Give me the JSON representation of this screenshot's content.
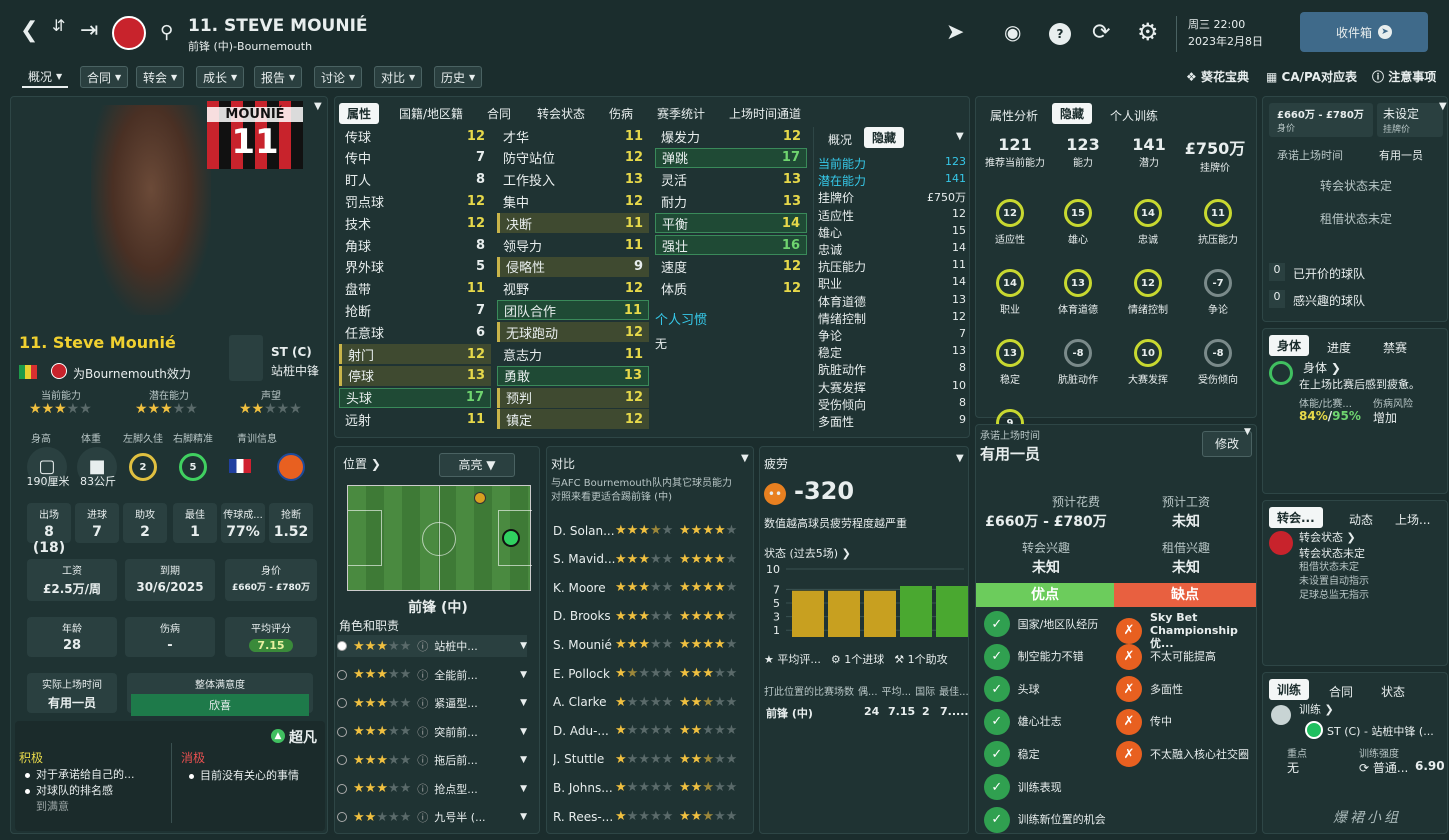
{
  "header": {
    "player_title": "11. STEVE MOUNIÉ",
    "subtitle": "前锋 (中)-Bournemouth",
    "day": "周三 22:00",
    "date": "2023年2月8日",
    "inbox_label": "收件箱"
  },
  "nav_menu": [
    "概况",
    "合同",
    "转会",
    "成长",
    "报告",
    "讨论",
    "对比",
    "历史"
  ],
  "nav_right": [
    "葵花宝典",
    "CA/PA对应表",
    "注意事项"
  ],
  "profile": {
    "shirt_name": "MOUNIÉ",
    "shirt_number": "11",
    "name": "11. Steve Mounié",
    "club_line": "为Bournemouth效力",
    "position": "ST (C)",
    "role": "站桩中锋",
    "labels": {
      "ca": "当前能力",
      "pa": "潜在能力",
      "rep": "声望",
      "height": "身高",
      "weight": "体重",
      "left": "左脚久佳",
      "right": "右脚精准",
      "youth": "青训信息"
    },
    "height": "190厘米",
    "weight": "83公斤",
    "left_foot": "2",
    "right_foot": "5",
    "stats": [
      {
        "label": "出场",
        "value": "8 (18)"
      },
      {
        "label": "进球",
        "value": "7"
      },
      {
        "label": "助攻",
        "value": "2"
      },
      {
        "label": "最佳",
        "value": "1"
      },
      {
        "label": "传球成...",
        "value": "77%"
      },
      {
        "label": "抢断",
        "value": "1.52"
      }
    ],
    "wage_label": "工资",
    "wage": "£2.5万/周",
    "expiry_label": "到期",
    "expiry": "30/6/2025",
    "value_label": "身价",
    "value": "£660万 - £780万",
    "age_label": "年龄",
    "age": "28",
    "injury_label": "伤病",
    "injury": "-",
    "rating_label": "平均评分",
    "rating": "7.15",
    "playtime_label": "实际上场时间",
    "playtime": "有用一员",
    "happiness_label": "整体满意度",
    "happiness": "欣喜",
    "personality": "超凡",
    "positive_label": "积极",
    "negative_label": "消极",
    "positives": [
      "对于承诺给自己的...",
      "对球队的排名感",
      "到满意"
    ],
    "negatives": [
      "目前没有关心的事情"
    ]
  },
  "attr_tabs": [
    "属性",
    "国籍/地区籍",
    "合同",
    "转会状态",
    "伤病",
    "赛季统计",
    "上场时间通道"
  ],
  "technical": [
    {
      "name": "传球",
      "value": "12",
      "hl": ""
    },
    {
      "name": "传中",
      "value": "7",
      "hl": ""
    },
    {
      "name": "盯人",
      "value": "8",
      "hl": ""
    },
    {
      "name": "罚点球",
      "value": "12",
      "hl": ""
    },
    {
      "name": "技术",
      "value": "12",
      "hl": ""
    },
    {
      "name": "角球",
      "value": "8",
      "hl": ""
    },
    {
      "name": "界外球",
      "value": "5",
      "hl": ""
    },
    {
      "name": "盘带",
      "value": "11",
      "hl": ""
    },
    {
      "name": "抢断",
      "value": "7",
      "hl": ""
    },
    {
      "name": "任意球",
      "value": "6",
      "hl": ""
    },
    {
      "name": "射门",
      "value": "12",
      "hl": "y"
    },
    {
      "name": "停球",
      "value": "13",
      "hl": "y"
    },
    {
      "name": "头球",
      "value": "17",
      "hl": "g"
    },
    {
      "name": "远射",
      "value": "11",
      "hl": ""
    }
  ],
  "mental": [
    {
      "name": "才华",
      "value": "11",
      "hl": ""
    },
    {
      "name": "防守站位",
      "value": "12",
      "hl": ""
    },
    {
      "name": "工作投入",
      "value": "13",
      "hl": ""
    },
    {
      "name": "集中",
      "value": "12",
      "hl": ""
    },
    {
      "name": "决断",
      "value": "11",
      "hl": "y"
    },
    {
      "name": "领导力",
      "value": "11",
      "hl": ""
    },
    {
      "name": "侵略性",
      "value": "9",
      "hl": "y"
    },
    {
      "name": "视野",
      "value": "12",
      "hl": ""
    },
    {
      "name": "团队合作",
      "value": "11",
      "hl": "g"
    },
    {
      "name": "无球跑动",
      "value": "12",
      "hl": "y"
    },
    {
      "name": "意志力",
      "value": "11",
      "hl": ""
    },
    {
      "name": "勇敢",
      "value": "13",
      "hl": "g"
    },
    {
      "name": "预判",
      "value": "12",
      "hl": "y"
    },
    {
      "name": "镇定",
      "value": "12",
      "hl": "y"
    }
  ],
  "physical": [
    {
      "name": "爆发力",
      "value": "12",
      "hl": ""
    },
    {
      "name": "弹跳",
      "value": "17",
      "hl": "g"
    },
    {
      "name": "灵活",
      "value": "13",
      "hl": ""
    },
    {
      "name": "耐力",
      "value": "13",
      "hl": ""
    },
    {
      "name": "平衡",
      "value": "14",
      "hl": "g"
    },
    {
      "name": "强壮",
      "value": "16",
      "hl": "g"
    },
    {
      "name": "速度",
      "value": "12",
      "hl": ""
    },
    {
      "name": "体质",
      "value": "12",
      "hl": ""
    }
  ],
  "habits_label": "个人习惯",
  "habits_value": "无",
  "hidden_tabs": [
    "概况",
    "隐藏"
  ],
  "hidden": [
    {
      "name": "当前能力",
      "value": "123",
      "c": "cyan"
    },
    {
      "name": "潜在能力",
      "value": "141",
      "c": "cyan"
    },
    {
      "name": "挂牌价",
      "value": "£750万",
      "c": ""
    },
    {
      "name": "适应性",
      "value": "12",
      "c": ""
    },
    {
      "name": "雄心",
      "value": "15",
      "c": ""
    },
    {
      "name": "忠诚",
      "value": "14",
      "c": ""
    },
    {
      "name": "抗压能力",
      "value": "11",
      "c": ""
    },
    {
      "name": "职业",
      "value": "14",
      "c": ""
    },
    {
      "name": "体育道德",
      "value": "13",
      "c": ""
    },
    {
      "name": "情绪控制",
      "value": "12",
      "c": ""
    },
    {
      "name": "争论",
      "value": "7",
      "c": ""
    },
    {
      "name": "稳定",
      "value": "13",
      "c": ""
    },
    {
      "name": "肮脏动作",
      "value": "8",
      "c": ""
    },
    {
      "name": "大赛发挥",
      "value": "10",
      "c": ""
    },
    {
      "name": "受伤倾向",
      "value": "8",
      "c": ""
    },
    {
      "name": "多面性",
      "value": "9",
      "c": ""
    }
  ],
  "analysis_tabs": [
    "属性分析",
    "隐藏",
    "个人训练"
  ],
  "analysis_top": [
    {
      "value": "121",
      "label": "推荐当前能力"
    },
    {
      "value": "123",
      "label": "能力"
    },
    {
      "value": "141",
      "label": "潜力"
    },
    {
      "value": "£750万",
      "label": "挂牌价"
    }
  ],
  "gauges": [
    {
      "value": "12",
      "label": "适应性"
    },
    {
      "value": "15",
      "label": "雄心"
    },
    {
      "value": "14",
      "label": "忠诚"
    },
    {
      "value": "11",
      "label": "抗压能力"
    },
    {
      "value": "14",
      "label": "职业"
    },
    {
      "value": "13",
      "label": "体育道德"
    },
    {
      "value": "12",
      "label": "情绪控制"
    },
    {
      "value": "-7",
      "label": "争论"
    },
    {
      "value": "13",
      "label": "稳定"
    },
    {
      "value": "-8",
      "label": "肮脏动作"
    },
    {
      "value": "10",
      "label": "大赛发挥"
    },
    {
      "value": "-8",
      "label": "受伤倾向"
    },
    {
      "value": "9",
      "label": "多面性"
    }
  ],
  "transfer_box": {
    "value": "£660万 - £780万",
    "value_label": "身价",
    "asking": "未设定",
    "asking_label": "挂牌价",
    "promised_label": "承诺上场时间",
    "promised": "有用一员",
    "status1": "转会状态未定",
    "status2": "租借状态未定",
    "offers_count": "0",
    "offers": "已开价的球队",
    "interest_count": "0",
    "interest": "感兴趣的球队"
  },
  "body_tabs": [
    "身体",
    "进度",
    "禁赛"
  ],
  "body": {
    "title": "身体",
    "desc": "在上场比赛后感到疲惫。",
    "fit_label": "体能/比赛...",
    "risk_label": "伤病风险",
    "fit": "84%",
    "sharp": "95%",
    "risk": "增加"
  },
  "news_tabs": [
    "转会...",
    "动态",
    "上场..."
  ],
  "news": {
    "title": "转会状态",
    "status": "转会状态未定",
    "lines": [
      "租借状态未定",
      "未设置自动指示",
      "足球总监无指示"
    ]
  },
  "training_tabs": [
    "训练",
    "合同",
    "状态"
  ],
  "training": {
    "title": "训练",
    "role": "ST (C) - 站桩中锋 (...",
    "focus_label": "重点",
    "focus": "无",
    "intensity_label": "训练强度",
    "intensity": "普通...",
    "rating": "6.90"
  },
  "position_panel": {
    "title": "位置",
    "dropdown": "高亮",
    "pos_name": "前锋 (中)",
    "roles_title": "角色和职责",
    "roles": [
      {
        "name": "站桩中...",
        "stars": 3,
        "sel": true
      },
      {
        "name": "全能前...",
        "stars": 3,
        "sel": false
      },
      {
        "name": "紧逼型...",
        "stars": 3,
        "sel": false
      },
      {
        "name": "突前前...",
        "stars": 3,
        "sel": false
      },
      {
        "name": "拖后前...",
        "stars": 3,
        "sel": false
      },
      {
        "name": "抢点型...",
        "stars": 3,
        "sel": false
      },
      {
        "name": "九号半 (...",
        "stars": 2,
        "sel": false
      }
    ]
  },
  "compare": {
    "title": "对比",
    "desc": "与AFC Bournemouth队内其它球员能力对照来看更适合踢前锋 (中)",
    "players": [
      {
        "name": "D. Solan...",
        "s1": 3.5,
        "s2": 4
      },
      {
        "name": "S. Mavid...",
        "s1": 3,
        "s2": 4
      },
      {
        "name": "K. Moore",
        "s1": 3,
        "s2": 4
      },
      {
        "name": "D. Brooks",
        "s1": 3,
        "s2": 4
      },
      {
        "name": "S. Mounié",
        "s1": 3,
        "s2": 4
      },
      {
        "name": "E. Pollock",
        "s1": 1.5,
        "s2": 3
      },
      {
        "name": "A. Clarke",
        "s1": 1,
        "s2": 2.5
      },
      {
        "name": "D. Adu-...",
        "s1": 1,
        "s2": 2
      },
      {
        "name": "J. Stuttle",
        "s1": 1,
        "s2": 2.5
      },
      {
        "name": "B. Johns...",
        "s1": 1,
        "s2": 2.5
      },
      {
        "name": "R. Rees-...",
        "s1": 1,
        "s2": 2.5
      }
    ]
  },
  "fatigue": {
    "title": "疲劳",
    "value": "-320",
    "desc": "数值越高球员疲劳程度越严重",
    "form_title": "状态 (过去5场)",
    "y_ticks": [
      "10",
      "7",
      "5",
      "3",
      "1"
    ],
    "ratings": [
      6.8,
      6.8,
      6.8,
      7.5,
      7.5
    ],
    "legend": [
      "平均评...",
      "1个进球",
      "1个助攻"
    ],
    "table_header": [
      "打此位置的比赛场数",
      "偶...",
      "平均...",
      "国际",
      "最佳..."
    ],
    "table_row": [
      "前锋 (中)",
      "24",
      "7.15",
      "2",
      "7....."
    ]
  },
  "playing_time": {
    "label": "承诺上场时间",
    "value": "有用一员",
    "edit": "修改",
    "fee_label": "预计花费",
    "fee": "£660万 - £780万",
    "wage_label": "预计工资",
    "wage": "未知",
    "tinterest_label": "转会兴趣",
    "tinterest": "未知",
    "linterest_label": "租借兴趣",
    "linterest": "未知",
    "pros_title": "优点",
    "cons_title": "缺点",
    "pros": [
      "国家/地区队经历",
      "制空能力不错",
      "头球",
      "雄心壮志",
      "稳定",
      "训练表现",
      "训练新位置的机会"
    ],
    "cons": [
      "Sky Bet Championship优...",
      "不太可能提高",
      "多面性",
      "传中",
      "不太融入核心社交圈"
    ]
  },
  "watermark": "爆裙小组"
}
